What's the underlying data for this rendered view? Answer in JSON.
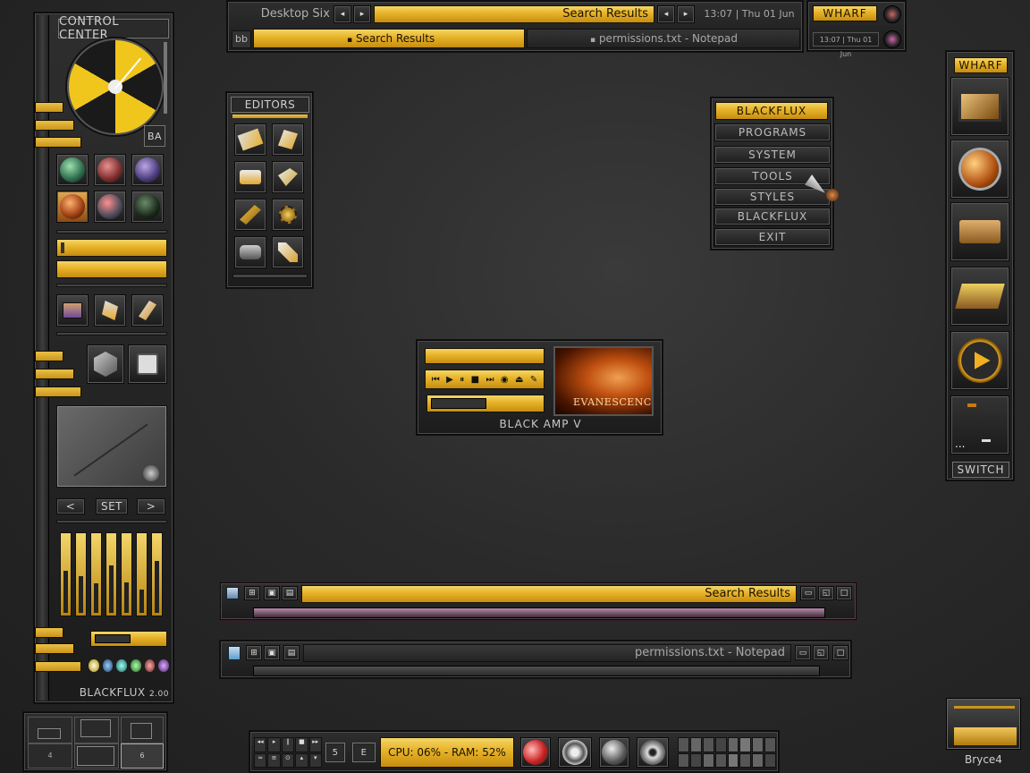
{
  "top_bar": {
    "workspace": "Desktop Six",
    "title": "Search Results",
    "clock": "13:07 | Thu 01 Jun",
    "clock_small": "13:07 | Thu 01 Jun",
    "tray_label": "bb",
    "tasks": [
      {
        "label": "Search Results",
        "active": true
      },
      {
        "label": "permissions.txt - Notepad",
        "active": false
      }
    ],
    "wharf_label": "WHARF"
  },
  "control_center": {
    "title": "CONTROL CENTER",
    "ba_label": "BA",
    "nav_prev": "<",
    "nav_set": "SET",
    "nav_next": ">",
    "footer": "BLACKFLUX",
    "version": "2.00",
    "eq_levels": [
      0.55,
      0.48,
      0.38,
      0.62,
      0.4,
      0.3,
      0.68
    ]
  },
  "editors": {
    "title": "EDITORS"
  },
  "blackflux_menu": {
    "title": "BLACKFLUX",
    "items": [
      {
        "label": "PROGRAMS",
        "active": false
      },
      {
        "label": "SYSTEM",
        "active": false
      },
      {
        "label": "TOOLS",
        "active": true
      },
      {
        "label": "STYLES",
        "active": false
      },
      {
        "label": "BLACKFLUX",
        "active": false
      },
      {
        "label": "EXIT",
        "active": false
      }
    ]
  },
  "amp": {
    "title": "BLACK AMP V",
    "album_text": "EVANESCENCE",
    "controls": [
      "prev",
      "play",
      "pause",
      "stop",
      "next",
      "eye",
      "eject",
      "edit"
    ]
  },
  "window_search": {
    "title": "Search Results"
  },
  "window_notepad": {
    "title": "permissions.txt - Notepad"
  },
  "wharf": {
    "title": "WHARF",
    "switch_label": "SWITCH",
    "pager_dots": "..."
  },
  "pager": {
    "desk_labels": [
      "4",
      "6"
    ]
  },
  "bottom_bar": {
    "desk_a": "5",
    "desk_b": "E",
    "cpu_ram": "CPU: 06% - RAM: 52%"
  },
  "bryce": {
    "label": "Bryce4"
  },
  "colors": {
    "gold": "#e9b52b",
    "panel": "#222222",
    "accent_pink": "#c46aa0"
  }
}
